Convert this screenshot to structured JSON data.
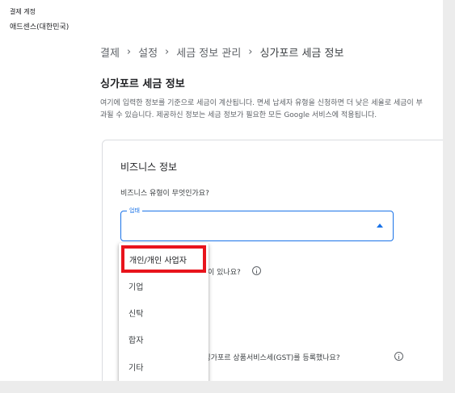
{
  "header": {
    "account_label": "결제 계정",
    "account_name": "애드센스(대한민국)"
  },
  "breadcrumb": {
    "items": [
      "결제",
      "설정",
      "세금 정보 관리",
      "싱가포르 세금 정보"
    ],
    "separator": "›"
  },
  "section": {
    "title": "싱가포르 세금 정보",
    "description": "여기에 입력한 정보를 기준으로 세금이 계산됩니다. 면세 납세자 유형을 신청하면 더 낮은 세율로 세금이 부과될 수 있습니다. 제공하신 정보는 세금 정보가 필요한 모든 Google 서비스에 적용됩니다."
  },
  "card": {
    "title": "비즈니스 정보",
    "question_business_type": "비즈니스 유형이 무엇인가요?",
    "select_label": "업태",
    "select_value": "",
    "question_partial_visible": "이 있나요?",
    "question_gst_partial": "따라 싱가포르 상품서비스세(GST)를 등록했나요?"
  },
  "dropdown": {
    "options": [
      "개인/개인 사업자",
      "기업",
      "신탁",
      "합자",
      "기타"
    ],
    "highlighted": "개인/개인 사업자"
  },
  "colors": {
    "accent": "#1a73e8",
    "highlight_border": "#e8141c",
    "card_border": "#dadce0"
  },
  "icons": {
    "info": "info-icon",
    "dropdown_arrow": "arrow-up-icon"
  }
}
